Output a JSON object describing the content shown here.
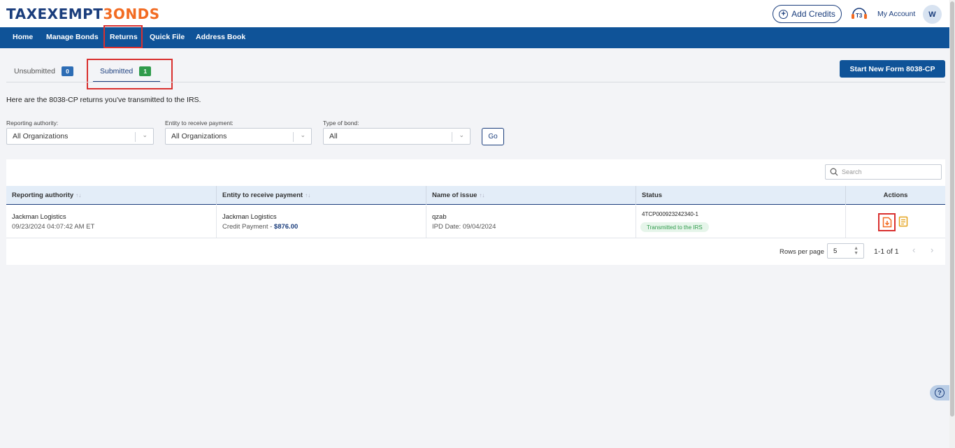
{
  "header": {
    "logo_part1": "TAXEXEMPT",
    "logo_part2": "3ONDS",
    "add_credits": "Add Credits",
    "my_account": "My Account",
    "avatar_initial": "W"
  },
  "nav": {
    "items": [
      "Home",
      "Manage Bonds",
      "Returns",
      "Quick File",
      "Address Book"
    ],
    "active": "Returns"
  },
  "tabs": {
    "unsubmitted": {
      "label": "Unsubmitted",
      "count": "0"
    },
    "submitted": {
      "label": "Submitted",
      "count": "1"
    }
  },
  "start_new_button": "Start New Form 8038-CP",
  "intro_text": "Here are the 8038-CP returns you've transmitted to the IRS.",
  "filters": {
    "reporting_authority": {
      "label": "Reporting authority:",
      "value": "All Organizations"
    },
    "entity": {
      "label": "Entity to receive payment:",
      "value": "All Organizations"
    },
    "bond_type": {
      "label": "Type of bond:",
      "value": "All"
    },
    "go_label": "Go"
  },
  "search": {
    "placeholder": "Search"
  },
  "table": {
    "columns": [
      "Reporting authority",
      "Entity to receive payment",
      "Name of issue",
      "Status",
      "Actions"
    ],
    "rows": [
      {
        "reporting_authority": "Jackman Logistics",
        "timestamp": "09/23/2024 04:07:42 AM ET",
        "entity": "Jackman Logistics",
        "payment_label": "Credit Payment - ",
        "payment_amount": "$876.00",
        "issue_name": "qzab",
        "ipd_date": "IPD Date: 09/04/2024",
        "submission_id": "4TCP000923242340-1",
        "status": "Transmitted to the IRS"
      }
    ]
  },
  "pagination": {
    "rows_per_page_label": "Rows per page",
    "rows_per_page": "5",
    "range": "1-1 of 1"
  },
  "colors": {
    "brand_blue": "#0f5398",
    "brand_orange": "#f26b22",
    "status_green": "#2f9b4b",
    "highlight_red": "#d9302f"
  }
}
